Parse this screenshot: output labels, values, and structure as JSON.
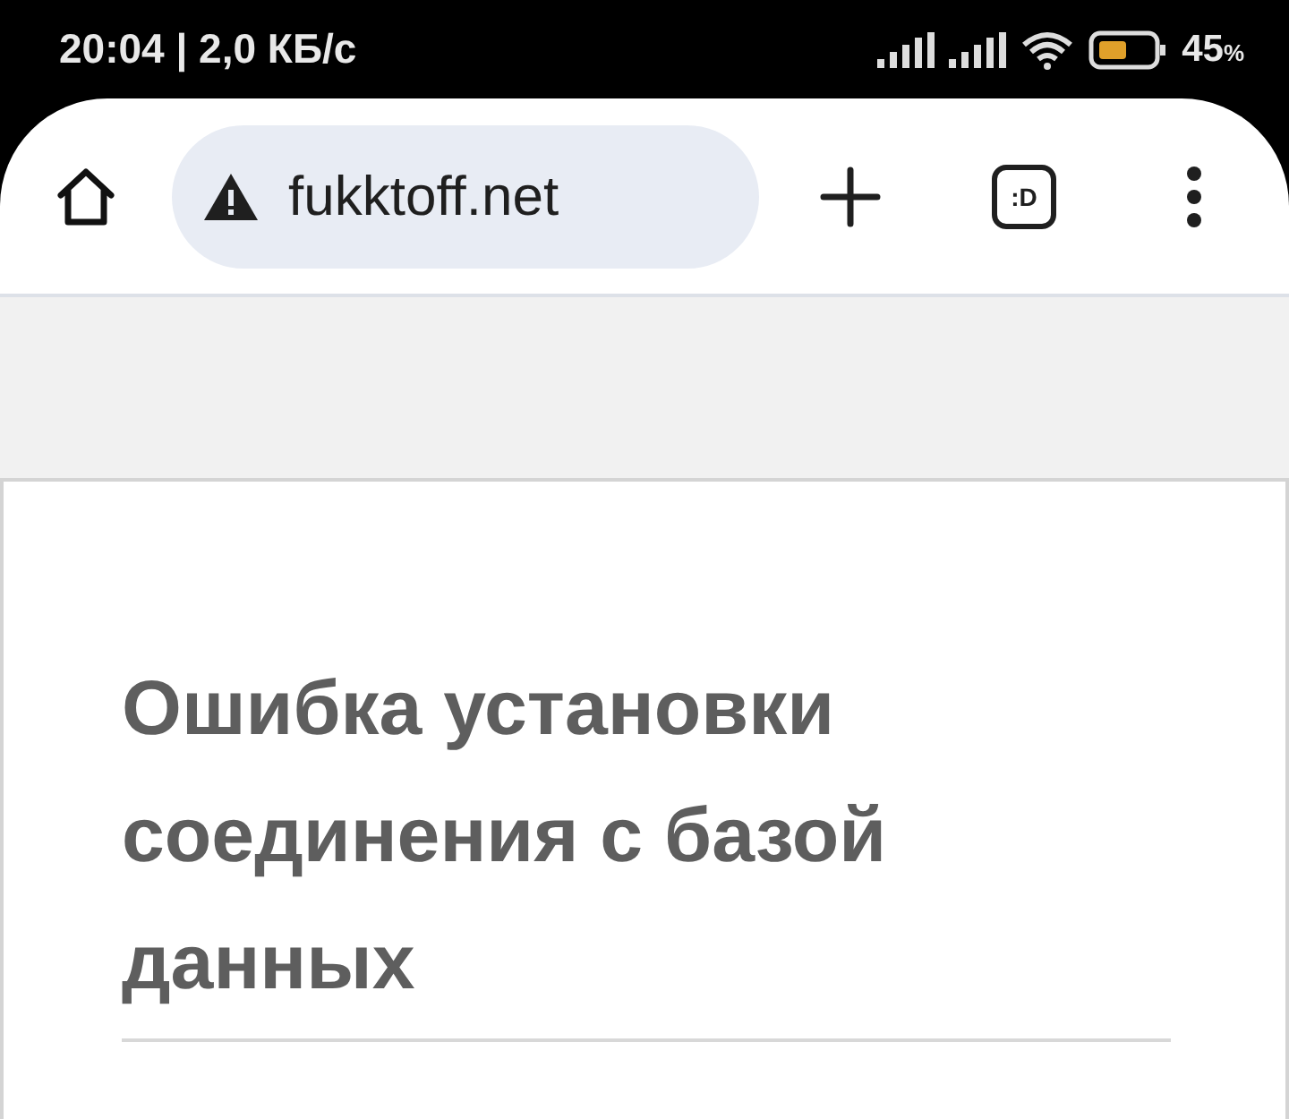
{
  "status_bar": {
    "time_speed": "20:04 | 2,0 КБ/с",
    "battery": "45",
    "battery_unit": "%"
  },
  "toolbar": {
    "url": "fukktoff.net",
    "tab_switcher": ":D"
  },
  "page": {
    "heading": "Ошибка установки соединения с базой данных"
  }
}
